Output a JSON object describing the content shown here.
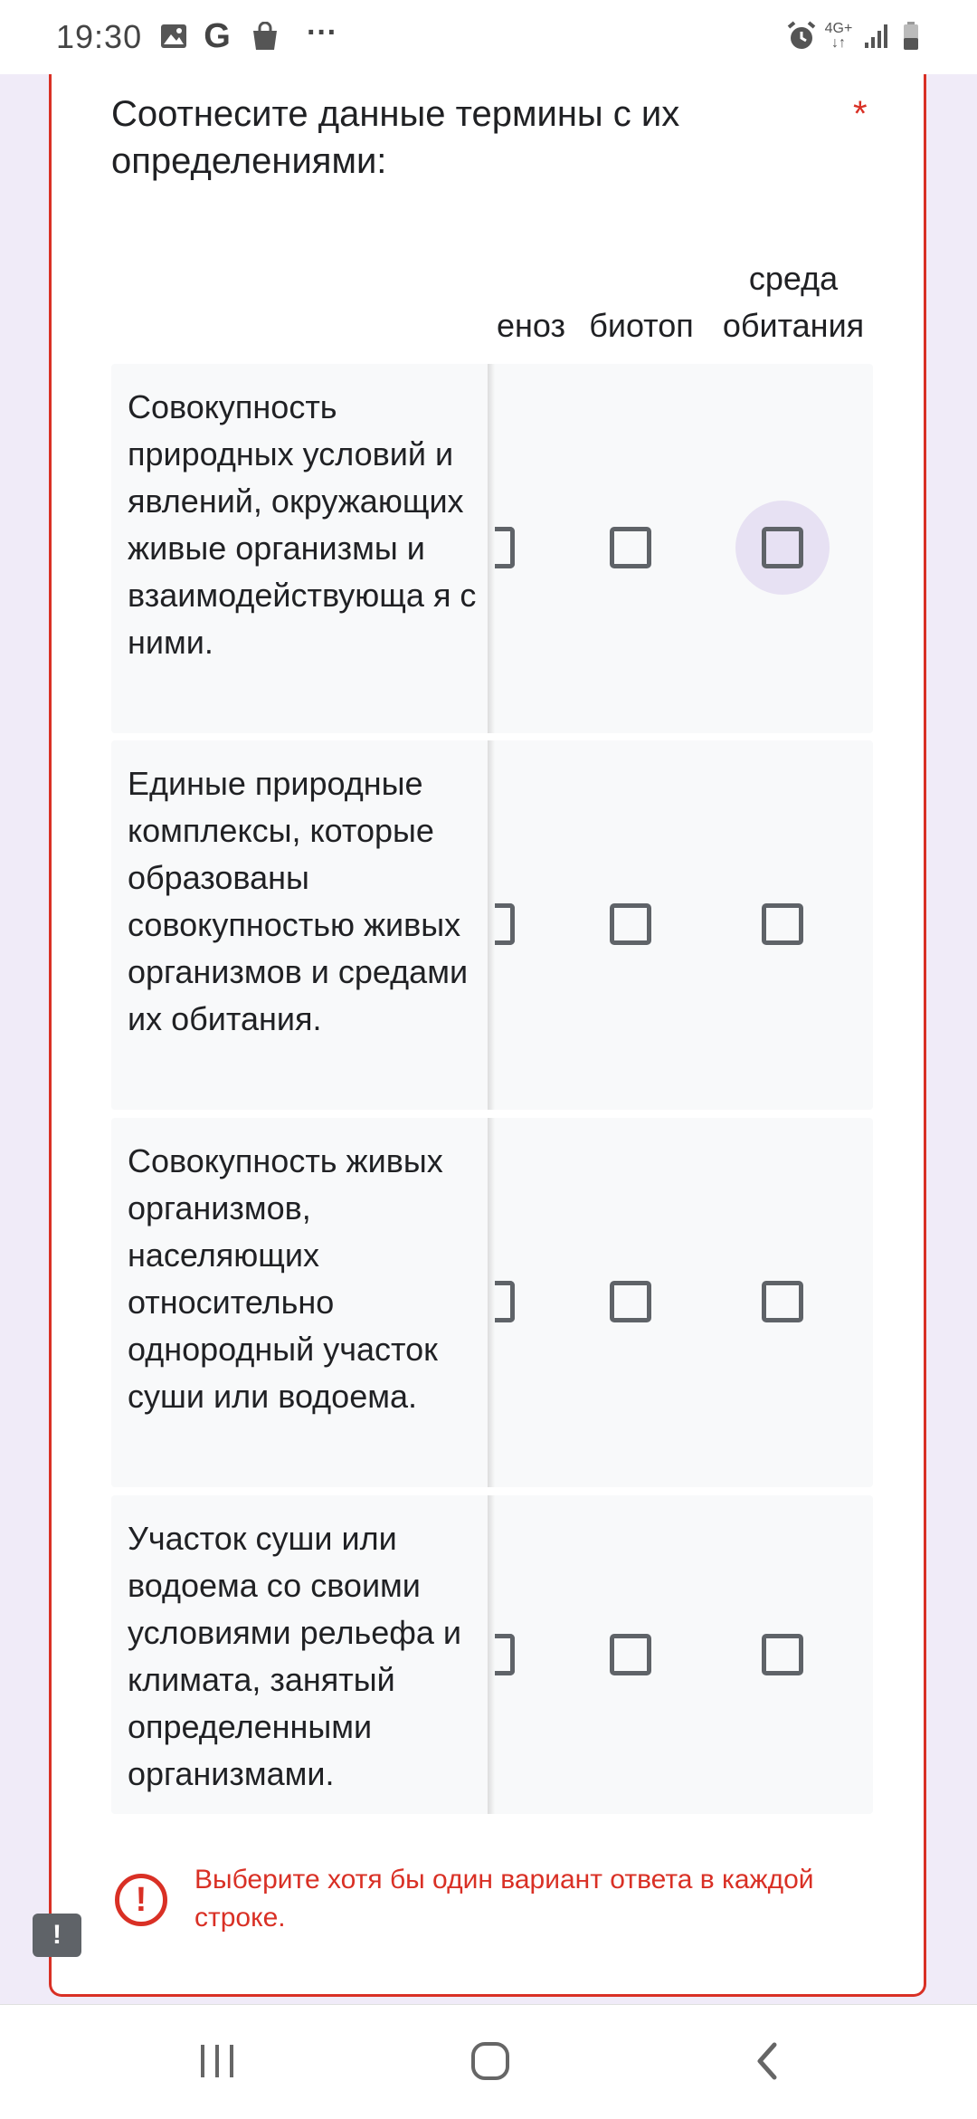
{
  "status_bar": {
    "time": "19:30",
    "g_label": "G",
    "more": "···",
    "network_top": "4G+",
    "network_bottom": "↓↑",
    "icons": [
      "gallery-icon",
      "google-icon",
      "shopping-bag-icon",
      "more-icon",
      "alarm-icon",
      "network-4g-icon",
      "signal-icon",
      "battery-icon"
    ]
  },
  "question": {
    "text": "Соотнесите данные термины с их определениями:",
    "required_mark": "*"
  },
  "columns": [
    "еноз",
    "биотоп",
    "среда обитания"
  ],
  "rows": [
    {
      "label": "Совокупность природных условий и явлений, окружающих живые организмы и взаимодействующа я с ними.",
      "checked": [
        false,
        false,
        false
      ],
      "focused_col": 2
    },
    {
      "label": "Единые природные комплексы, которые образованы совокупностью живых организмов и средами их обитания.",
      "checked": [
        false,
        false,
        false
      ]
    },
    {
      "label": "Совокупность живых организмов, населяющих относительно однородный участок суши или водоема.",
      "checked": [
        false,
        false,
        false
      ]
    },
    {
      "label": "Участок суши или водоема со своими условиями рельефа и климата, занятый определенными организмами.",
      "checked": [
        false,
        false,
        false
      ]
    }
  ],
  "error": {
    "icon": "!",
    "text": "Выберите хотя бы один вариант ответа в каждой строке."
  },
  "feedback_icon": "!",
  "colors": {
    "accent": "#673ab7",
    "error": "#d93025",
    "background": "#f0ebf8",
    "row_background": "#f8f9fa"
  }
}
